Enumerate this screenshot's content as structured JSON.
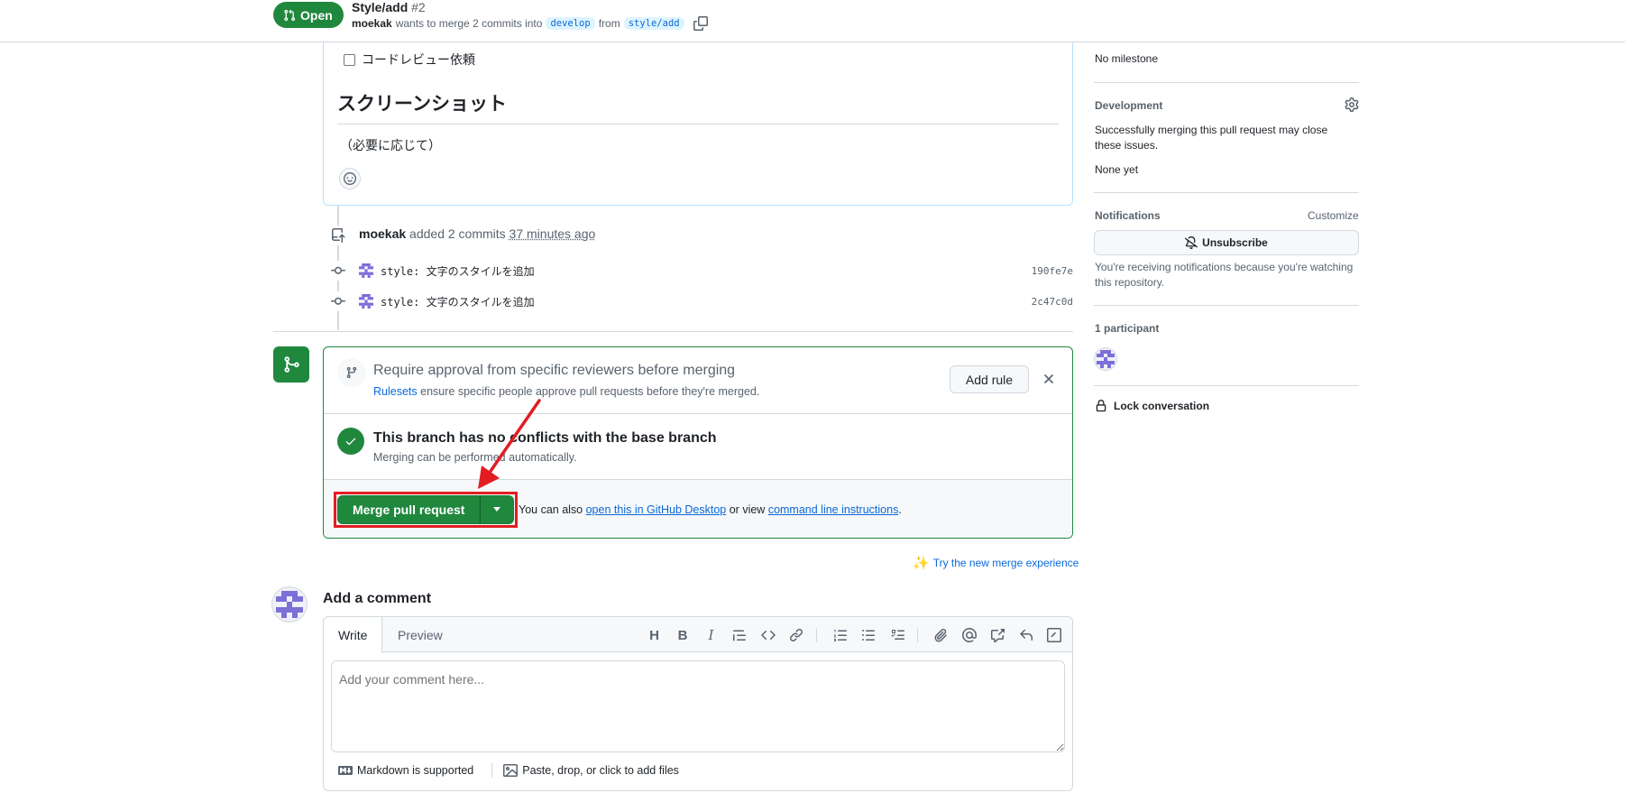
{
  "header": {
    "state_label": "Open",
    "title": "Style/add",
    "number": "#2",
    "author": "moekak",
    "merge_text_1": "wants to merge 2 commits into",
    "base_branch": "develop",
    "merge_text_2": "from",
    "head_branch": "style/add"
  },
  "description": {
    "task_label": "コードレビュー依頼",
    "heading": "スクリーンショット",
    "note": "（必要に応じて）"
  },
  "timeline": {
    "event_author": "moekak",
    "event_text": "added 2 commits",
    "event_time": "37 minutes ago",
    "commits": [
      {
        "message": "style: 文字のスタイルを追加",
        "sha": "190fe7e"
      },
      {
        "message": "style: 文字のスタイルを追加",
        "sha": "2c47c0d"
      }
    ]
  },
  "merge_box": {
    "rule_title": "Require approval from specific reviewers before merging",
    "rule_link": "Rulesets",
    "rule_sub": "ensure specific people approve pull requests before they're merged.",
    "add_rule_label": "Add rule",
    "ok_title": "This branch has no conflicts with the base branch",
    "ok_sub": "Merging can be performed automatically.",
    "merge_label": "Merge pull request",
    "also_1": "You can also",
    "desktop_link": "open this in GitHub Desktop",
    "also_2": "or view",
    "cli_link": "command line instructions",
    "also_3": "."
  },
  "try_new": "Try the new merge experience",
  "comment": {
    "heading": "Add a comment",
    "tab_write": "Write",
    "tab_preview": "Preview",
    "placeholder": "Add your comment here...",
    "markdown_label": "Markdown is supported",
    "attach_label": "Paste, drop, or click to add files"
  },
  "sidebar": {
    "milestone_value": "No milestone",
    "development_label": "Development",
    "development_text": "Successfully merging this pull request may close these issues.",
    "development_value": "None yet",
    "notifications_label": "Notifications",
    "customize_label": "Customize",
    "unsubscribe_label": "Unsubscribe",
    "notifications_text": "You're receiving notifications because you're watching this repository.",
    "participants_label": "1 participant",
    "lock_label": "Lock conversation"
  },
  "colors": {
    "accent_green": "#1f883d",
    "link_blue": "#0969da",
    "annotation_red": "#e11d21"
  }
}
